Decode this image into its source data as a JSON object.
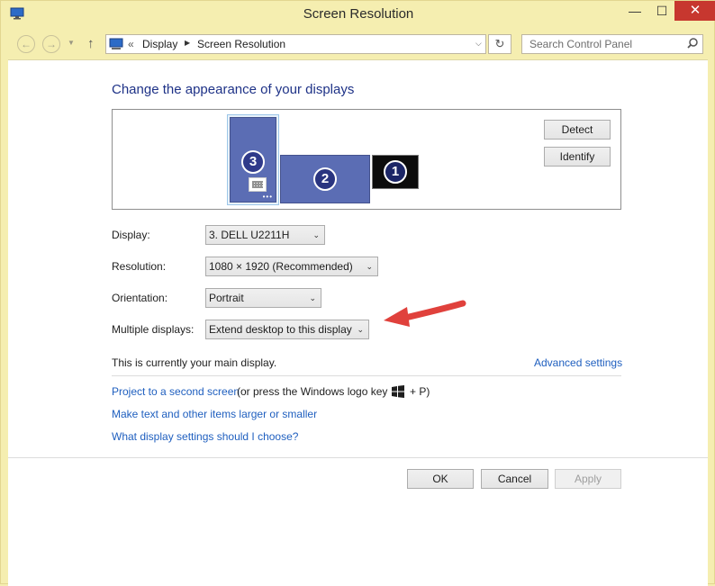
{
  "window": {
    "title": "Screen Resolution",
    "minimize_glyph": "—",
    "maximize_glyph": "☐",
    "close_glyph": "✕"
  },
  "nav": {
    "back_glyph": "←",
    "forward_glyph": "→",
    "recent_glyph": "▼",
    "up_glyph": "↑",
    "breadcrumb_prefix": "«",
    "breadcrumbs": [
      "Display",
      "Screen Resolution"
    ],
    "crumb_separator": "▶",
    "dropdown_glyph": "⌵",
    "refresh_glyph": "↻",
    "search_placeholder": "Search Control Panel"
  },
  "main": {
    "heading": "Change the appearance of your displays",
    "monitors": [
      {
        "number": "3",
        "selected": true
      },
      {
        "number": "2",
        "selected": false
      },
      {
        "number": "1",
        "selected": false
      }
    ],
    "monitor_dots": "•••",
    "detect_label": "Detect",
    "identify_label": "Identify",
    "settings": {
      "display_label": "Display:",
      "display_value": "3. DELL U2211H",
      "resolution_label": "Resolution:",
      "resolution_value": "1080 × 1920 (Recommended)",
      "orientation_label": "Orientation:",
      "orientation_value": "Portrait",
      "multiple_label": "Multiple displays:",
      "multiple_value": "Extend desktop to this display"
    },
    "dropdown_arrow": "⌄",
    "main_display_text": "This is currently your main display.",
    "advanced_link": "Advanced settings",
    "project_link": "Project to a second screen",
    "project_text_before": "(or press the Windows logo key",
    "project_text_after": "+ P)",
    "text_size_link": "Make text and other items larger or smaller",
    "help_link": "What display settings should I choose?"
  },
  "footer": {
    "ok_label": "OK",
    "cancel_label": "Cancel",
    "apply_label": "Apply"
  },
  "icons": {
    "app": "monitor-icon",
    "search": "search-icon",
    "windows_logo": "windows-logo-icon",
    "annotation": "red-arrow-icon"
  },
  "colors": {
    "titlebar_bg": "#f5eeb0",
    "close_button": "#c7372f",
    "heading": "#1e3287",
    "link": "#1f5fbf",
    "monitor": "#5b6db4",
    "arrow": "#e0413c"
  }
}
